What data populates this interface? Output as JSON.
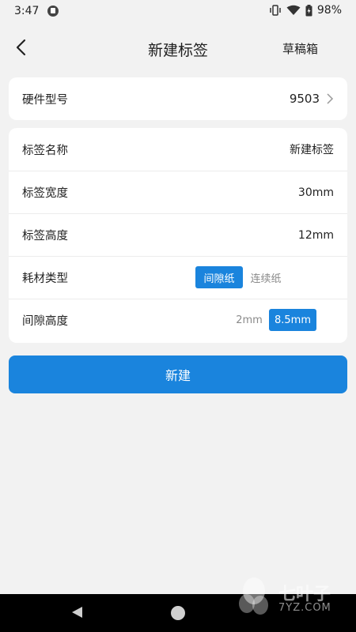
{
  "status_bar": {
    "time": "3:47",
    "battery": "98%"
  },
  "app_bar": {
    "title": "新建标签",
    "drafts_label": "草稿箱"
  },
  "hardware": {
    "label": "硬件型号",
    "value": "9503"
  },
  "fields": {
    "name": {
      "label": "标签名称",
      "value": "新建标签"
    },
    "width": {
      "label": "标签宽度",
      "value": "30mm"
    },
    "height": {
      "label": "标签高度",
      "value": "12mm"
    },
    "material": {
      "label": "耗材类型",
      "options": [
        "间隙纸",
        "连续纸"
      ],
      "selected": "间隙纸"
    },
    "gap": {
      "label": "间隙高度",
      "options": [
        "2mm",
        "8.5mm"
      ],
      "selected": "8.5mm"
    }
  },
  "create_button": "新建",
  "watermark": {
    "text": "七叶子",
    "sub": "7YZ.COM"
  },
  "colors": {
    "accent": "#1a84dd",
    "background": "#f2f2f2"
  }
}
